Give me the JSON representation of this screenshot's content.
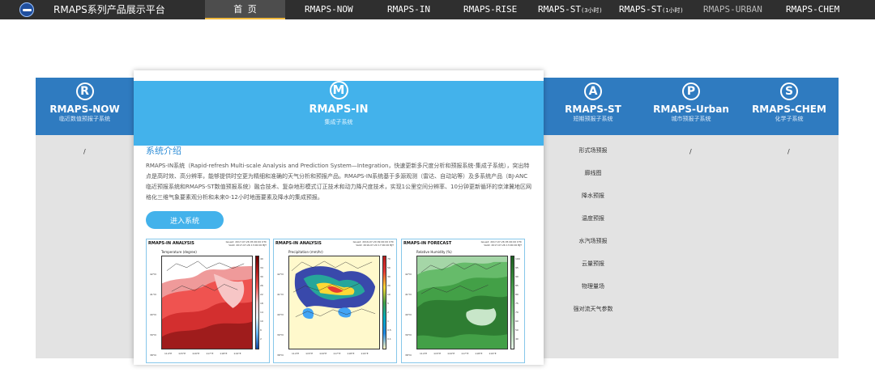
{
  "header": {
    "brand": "RMAPS系列产品展示平台",
    "nav": [
      {
        "label": "首 页",
        "sub": "",
        "state": "active"
      },
      {
        "label": "RMAPS-NOW",
        "sub": "",
        "state": "normal"
      },
      {
        "label": "RMAPS-IN",
        "sub": "",
        "state": "normal"
      },
      {
        "label": "RMAPS-RISE",
        "sub": "",
        "state": "normal"
      },
      {
        "label": "RMAPS-ST",
        "sub": "(3小时)",
        "state": "normal"
      },
      {
        "label": "RMAPS-ST",
        "sub": "(1小时)",
        "state": "normal"
      },
      {
        "label": "RMAPS-URBAN",
        "sub": "",
        "state": "muted"
      },
      {
        "label": "RMAPS-CHEM",
        "sub": "",
        "state": "normal"
      }
    ]
  },
  "subsystems": [
    {
      "letter": "R",
      "title": "RMAPS-NOW",
      "desc": "临近数值预报子系统",
      "content": "/"
    },
    {
      "letter": "A",
      "title": "RMAPS-ST",
      "desc": "短期预报子系统",
      "content": ""
    },
    {
      "letter": "P",
      "title": "RMAPS-Urban",
      "desc": "城市预报子系统",
      "content": "/"
    },
    {
      "letter": "S",
      "title": "RMAPS-CHEM",
      "desc": "化学子系统",
      "content": "/"
    }
  ],
  "featured": {
    "letter": "M",
    "title": "RMAPS-IN",
    "subtitle": "集成子系统",
    "section_title": "系统介绍",
    "description": "RMAPS-IN系统（Rapid-refresh Multi-scale Analysis and Prediction System—Integration，快速更新多尺度分析和预报系统-集成子系统），突出特点是高时效、高分辨率，能够提供时空更为精细和准确的天气分析和预报产品。RMAPS-IN系统基于多源观测（雷达、自动站等）及多系统产品（BJ-ANC临近预报系统和RMAPS-ST数值预报系统）融合技术、复杂地形模式订正技术和动力降尺度技术，实现1公里空间分辨率、10分钟更新循环的京津冀地区网格化三维气象要素观分析和未来0-12小时地面要素及降水的集成预报。",
    "button": "进入系统",
    "maps": [
      {
        "head": "RMAPS-IN ANALYSIS",
        "meta1": "Issued: 2017-07-26 05:00:00 UTC",
        "meta2": "Valid: 2017-07-26 13:00:00 BJT",
        "caption": "Temperature (degree)",
        "kind": "temperature"
      },
      {
        "head": "RMAPS-IN ANALYSIS",
        "meta1": "Issued: 2016-07-20 09:00:00 UTC",
        "meta2": "Valid: 2016-07-20 17:00:00 BJT",
        "caption": "Precipitation (mm/hr)",
        "kind": "precip"
      },
      {
        "head": "RMAPS-IN FORECAST",
        "meta1": "Issued: 2017-07-26 05:00:00 UTC",
        "meta2": "Valid: 2017-07-26 13:00:00 BJT",
        "caption": "Relative Humidity (%)",
        "kind": "humidity"
      }
    ]
  },
  "st_list": [
    "形式场预报",
    "廓线图",
    "降水预报",
    "温度预报",
    "水汽场预报",
    "云量预报",
    "物理量场",
    "强对流天气参数"
  ]
}
